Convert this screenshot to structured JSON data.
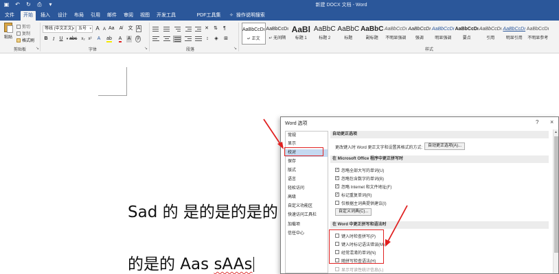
{
  "window": {
    "title": "新建 DOCX 文档 - Word"
  },
  "tabs": [
    "文件",
    "开始",
    "插入",
    "设计",
    "布局",
    "引用",
    "邮件",
    "审阅",
    "视图",
    "开发工具",
    "PDF工具集"
  ],
  "tell_me": "操作说明搜索",
  "ribbon": {
    "clipboard": {
      "paste": "粘贴",
      "cut": "剪切",
      "copy": "复制",
      "format_painter": "格式刷",
      "label": "剪贴板"
    },
    "font": {
      "name": "等线 (中文正文)",
      "size": "五号",
      "grow": "A",
      "shrink": "A",
      "label": "字体"
    },
    "paragraph": {
      "label": "段落"
    },
    "styles": {
      "label": "样式",
      "items": [
        {
          "preview": "AaBbCcDı",
          "name": "↵ 正文"
        },
        {
          "preview": "AaBbCcDı",
          "name": "↵ 无间隔"
        },
        {
          "preview": "AaBl",
          "name": "标题 1"
        },
        {
          "preview": "AaBbC",
          "name": "标题 2"
        },
        {
          "preview": "AaBbC",
          "name": "标题"
        },
        {
          "preview": "AaBbC",
          "name": "副标题"
        },
        {
          "preview": "AaBbCcDı",
          "name": "不明显强调"
        },
        {
          "preview": "AaBbCcDı",
          "name": "强调"
        },
        {
          "preview": "AaBbCcDı",
          "name": "明显强调"
        },
        {
          "preview": "AaBbCcDı",
          "name": "要点"
        },
        {
          "preview": "AaBbCcDı",
          "name": "引用"
        },
        {
          "preview": "AaBbCcDı",
          "name": "明显引用"
        },
        {
          "preview": "AaBbCcDı",
          "name": "不明显参考"
        }
      ]
    }
  },
  "document": {
    "line1": "Sad 的  是的是的是的",
    "line2_plain": "的是的  Aas ",
    "line2_flagged": "sAAs"
  },
  "dialog": {
    "title": "Word 选项",
    "help": "?",
    "close": "×",
    "nav": [
      "常规",
      "显示",
      "校对",
      "保存",
      "版式",
      "语言",
      "轻松访问",
      "高级",
      "自定义功能区",
      "快速访问工具栏",
      "加载项",
      "信任中心"
    ],
    "autocorrect_section": "自动更正选项",
    "autocorrect_text": "更改键入时 Word 更正文字和设置其格式的方式:",
    "autocorrect_button": "自动更正选项(A)...",
    "office_section": "在 Microsoft Office 程序中更正拼写时",
    "office_options": [
      {
        "label": "忽略全部大写的单词(U)",
        "checked": "✓"
      },
      {
        "label": "忽略包含数字的单词(B)",
        "checked": "✓"
      },
      {
        "label": "忽略 Internet 和文件地址(F)",
        "checked": "✓"
      },
      {
        "label": "标记重复单词(R)",
        "checked": "✓"
      },
      {
        "label": "仅根据主词典提供建议(I)",
        "checked": ""
      }
    ],
    "custom_dict_button": "自定义词典(C)...",
    "word_section": "在 Word 中更正拼写和语法时",
    "word_options": [
      {
        "label": "键入时检查拼写(P)",
        "checked": ""
      },
      {
        "label": "键入时标记语法错误(M)",
        "checked": ""
      },
      {
        "label": "经常混淆的单词(N)",
        "checked": ""
      },
      {
        "label": "随拼写检查语法(H)",
        "checked": ""
      }
    ],
    "partial_option": "显示可读性统计信息(L)"
  },
  "annotation_color": "#e02020"
}
